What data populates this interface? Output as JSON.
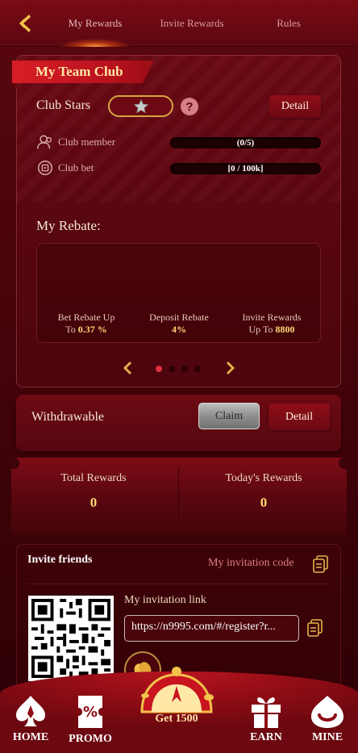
{
  "tabs": [
    {
      "label": "My Rewards",
      "active": true
    },
    {
      "label": "Invite Rewards",
      "active": false
    },
    {
      "label": "Rules",
      "active": false
    }
  ],
  "team_club": {
    "title": "My Team Club",
    "club_stars_label": "Club Stars",
    "help": "?",
    "detail_label": "Detail",
    "club_member": {
      "label": "Club member",
      "value": "(0/5)",
      "progress": 0
    },
    "club_bet": {
      "label": "Club bet",
      "value": "[0 / 100k]",
      "progress": 0
    }
  },
  "rebate": {
    "title": "My Rebate:",
    "items": [
      {
        "line1": "Bet Rebate Up",
        "prefix": "To ",
        "value": "0.37 %"
      },
      {
        "line1": "Deposit Rebate",
        "prefix": "",
        "value": "4%"
      },
      {
        "line1": "Invite Rewards",
        "prefix": "Up To ",
        "value": "8800"
      }
    ],
    "page_count": 4,
    "active_page": 0
  },
  "withdraw": {
    "label": "Withdrawable",
    "claim_label": "Claim",
    "detail_label": "Detail"
  },
  "rewards": {
    "total_label": "Total Rewards",
    "total_value": "0",
    "today_label": "Today's Rewards",
    "today_value": "0"
  },
  "invite": {
    "title": "Invite friends",
    "code_label": "My invitation code",
    "link_label": "My invitation link",
    "link_value": "https://n9995.com/#/register?r..."
  },
  "bottom_nav": {
    "home": "HOME",
    "promo": "PROMO",
    "get": "Get 1500",
    "earn": "EARN",
    "mine": "MINE"
  },
  "colors": {
    "accent_gold": "#ffd876",
    "brand_red": "#d81d27",
    "background": "#4a0309"
  }
}
